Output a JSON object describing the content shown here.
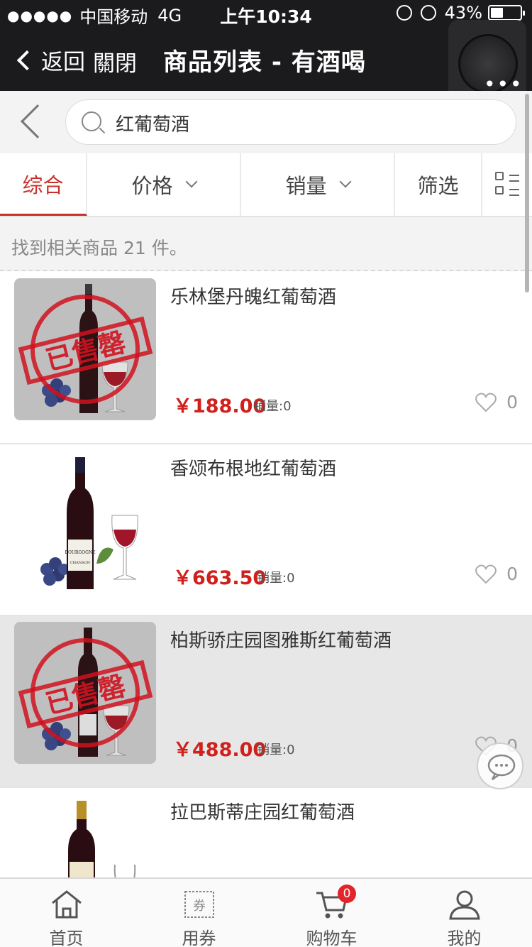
{
  "status_bar": {
    "signal": "●●●●●",
    "carrier": "中国移动",
    "network": "4G",
    "time": "上午10:34",
    "battery": "43%",
    "battery_level": 0.43
  },
  "nav": {
    "back_label": "返回",
    "close_label": "關閉",
    "title": "商品列表 - 有酒喝"
  },
  "search": {
    "value": "红葡萄酒"
  },
  "sort_tabs": [
    {
      "label": "综合",
      "active": true
    },
    {
      "label": "价格"
    },
    {
      "label": "销量"
    },
    {
      "label": "筛选"
    }
  ],
  "result_count_text": "找到相关商品 21 件。",
  "products": [
    {
      "name": "乐林堡丹魄红葡萄酒",
      "price": "￥188.00",
      "sales": "销量:0",
      "favorites": "0",
      "sold_out": true,
      "sold_out_text": "已售罄"
    },
    {
      "name": "香颂布根地红葡萄酒",
      "price": "￥663.50",
      "sales": "销量:0",
      "favorites": "0",
      "sold_out": false
    },
    {
      "name": "柏斯骄庄园图雅斯红葡萄酒",
      "price": "￥488.00",
      "sales": "销量:0",
      "favorites": "0",
      "sold_out": true,
      "sold_out_text": "已售罄"
    },
    {
      "name": "拉巴斯蒂庄园红葡萄酒",
      "price": "",
      "sales": "",
      "favorites": "",
      "sold_out": false
    }
  ],
  "bottom_nav": [
    {
      "label": "首页",
      "icon": "home-icon"
    },
    {
      "label": "用券",
      "icon": "coupon-icon",
      "icon_text": "券"
    },
    {
      "label": "购物车",
      "icon": "cart-icon"
    },
    {
      "label": "我的",
      "icon": "user-icon"
    }
  ],
  "cart_badge": "0",
  "colors": {
    "accent": "#c9302c",
    "price": "#d0201b",
    "header_bg": "#1b1b1d"
  }
}
